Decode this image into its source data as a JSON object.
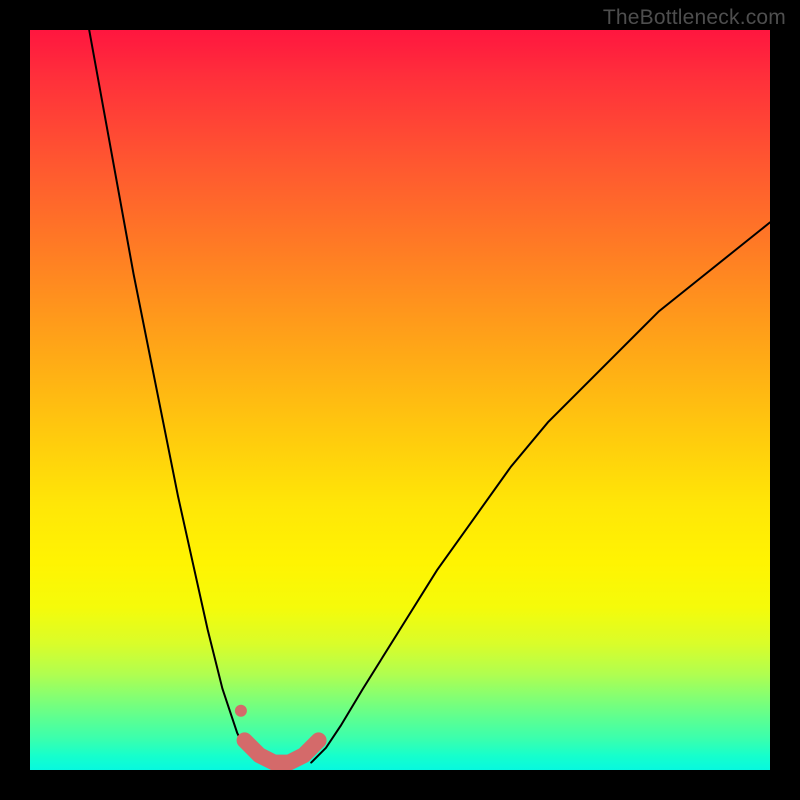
{
  "watermark": "TheBottleneck.com",
  "chart_data": {
    "type": "line",
    "title": "",
    "xlabel": "",
    "ylabel": "",
    "xlim": [
      0,
      100
    ],
    "ylim": [
      0,
      100
    ],
    "grid": false,
    "legend": false,
    "series": [
      {
        "name": "curve-left",
        "color": "#000000",
        "x": [
          8,
          10,
          12,
          14,
          16,
          18,
          20,
          22,
          24,
          26,
          27,
          28,
          29,
          30,
          31
        ],
        "y": [
          100,
          89,
          78,
          67,
          57,
          47,
          37,
          28,
          19,
          11,
          8,
          5,
          3,
          2,
          1
        ]
      },
      {
        "name": "curve-right",
        "color": "#000000",
        "x": [
          38,
          40,
          42,
          45,
          50,
          55,
          60,
          65,
          70,
          75,
          80,
          85,
          90,
          95,
          100
        ],
        "y": [
          1,
          3,
          6,
          11,
          19,
          27,
          34,
          41,
          47,
          52,
          57,
          62,
          66,
          70,
          74
        ]
      },
      {
        "name": "highlight-band",
        "color": "#d46a6a",
        "x": [
          29,
          31,
          33,
          35,
          37,
          39
        ],
        "y": [
          4,
          2,
          1,
          1,
          2,
          4
        ]
      },
      {
        "name": "highlight-dot",
        "color": "#d46a6a",
        "x": [
          28.5
        ],
        "y": [
          8
        ]
      }
    ],
    "notes": "Values are read off pixel positions relative to the 740×740 plot area; no axis ticks or numeric labels are present in the source image, so x and y are expressed as 0–100 percent of the plot width/height (y=0 at bottom)."
  }
}
